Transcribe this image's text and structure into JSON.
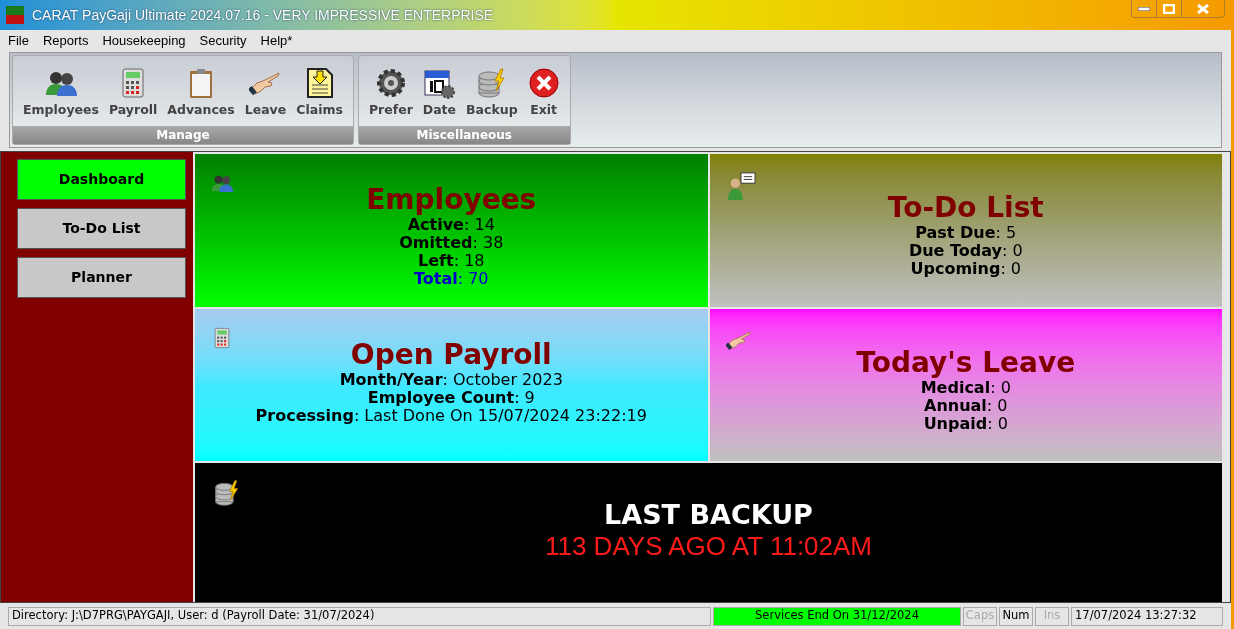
{
  "window": {
    "title": "CARAT PayGaji Ultimate 2024.07.16 - VERY IMPRESSIVE ENTERPRISE"
  },
  "menu": [
    "File",
    "Reports",
    "Housekeeping",
    "Security",
    "Help*"
  ],
  "toolbar": {
    "groups": [
      {
        "label": "Manage",
        "buttons": [
          {
            "label": "Employees",
            "kind": "people"
          },
          {
            "label": "Payroll",
            "kind": "calculator"
          },
          {
            "label": "Advances",
            "kind": "clipboard"
          },
          {
            "label": "Leave",
            "kind": "hand"
          },
          {
            "label": "Claims",
            "kind": "document"
          }
        ]
      },
      {
        "label": "Miscellaneous",
        "buttons": [
          {
            "label": "Prefer",
            "kind": "gear"
          },
          {
            "label": "Date",
            "kind": "calendar"
          },
          {
            "label": "Backup",
            "kind": "database"
          },
          {
            "label": "Exit",
            "kind": "exit"
          }
        ]
      }
    ]
  },
  "sidebar": {
    "items": [
      {
        "label": "Dashboard",
        "selected": true
      },
      {
        "label": "To-Do List",
        "selected": false
      },
      {
        "label": "Planner",
        "selected": false
      }
    ]
  },
  "tiles": [
    {
      "kind": "employees",
      "title": "Employees",
      "lines": [
        {
          "text": "**Active**: 14",
          "emphasis": false
        },
        {
          "text": "**Omitted**: 38",
          "emphasis": false
        },
        {
          "text": "**Left**: 18",
          "emphasis": false
        },
        {
          "text": "**Total**: 70",
          "emphasis": true
        }
      ]
    },
    {
      "kind": "todo",
      "title": "To-Do List",
      "lines": [
        {
          "text": "**Past Due**: 5",
          "emphasis": false
        },
        {
          "text": "**Due Today**: 0",
          "emphasis": false
        },
        {
          "text": "**Upcoming**: 0",
          "emphasis": false
        }
      ]
    },
    {
      "kind": "payroll",
      "title": "Open Payroll",
      "lines": [
        {
          "text": "**Month/Year**: October 2023",
          "emphasis": false
        },
        {
          "text": "**Employee Count**: 9",
          "emphasis": false
        },
        {
          "text": "**Processing**: Last Done On 15/07/2024 23:22:19",
          "emphasis": false
        }
      ]
    },
    {
      "kind": "leave",
      "title": "Today's Leave",
      "lines": [
        {
          "text": "**Medical**: 0",
          "emphasis": false
        },
        {
          "text": "**Annual**: 0",
          "emphasis": false
        },
        {
          "text": "**Unpaid**: 0",
          "emphasis": false
        }
      ]
    }
  ],
  "backup": {
    "title": "LAST BACKUP",
    "subtitle": "113 DAYS AGO AT 11:02AM"
  },
  "status_bar": [
    {
      "text": "Directory: J:\\D7PRG\\PAYGAJI, User: d (Payroll Date: 31/07/2024)",
      "kind": "path",
      "enabled": true
    },
    {
      "text": "Services End On 31/12/2024",
      "kind": "notice",
      "enabled": true
    },
    {
      "text": "Caps",
      "kind": "key",
      "enabled": false
    },
    {
      "text": "Num",
      "kind": "key",
      "enabled": true
    },
    {
      "text": "Ins",
      "kind": "key",
      "enabled": false
    },
    {
      "text": "17/07/2024 13:27:32",
      "kind": "clock",
      "enabled": true
    }
  ]
}
